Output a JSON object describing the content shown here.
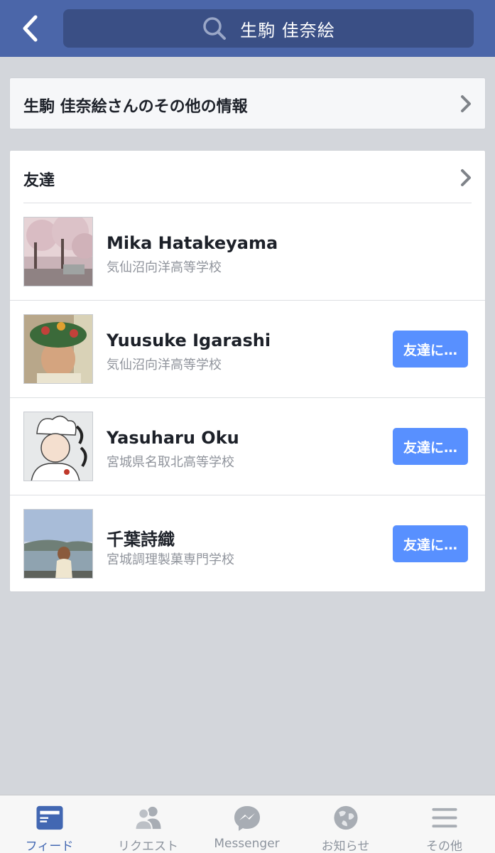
{
  "header": {
    "search_value": "生駒 佳奈絵"
  },
  "info_card": {
    "title": "生駒 佳奈絵さんのその他の情報"
  },
  "friends": {
    "title": "友達",
    "items": [
      {
        "name": "Mika Hatakeyama",
        "school": "気仙沼向洋高等学校",
        "button": ""
      },
      {
        "name": "Yuusuke Igarashi",
        "school": "気仙沼向洋高等学校",
        "button": "友達に…"
      },
      {
        "name": "Yasuharu Oku",
        "school": "宮城県名取北高等学校",
        "button": "友達に…"
      },
      {
        "name": "千葉詩織",
        "school": "宮城調理製菓専門学校",
        "button": "友達に…"
      }
    ]
  },
  "tabbar": {
    "tabs": [
      {
        "label": "フィード",
        "icon": "feed-icon",
        "active": true
      },
      {
        "label": "リクエスト",
        "icon": "friend-requests-icon",
        "active": false
      },
      {
        "label": "Messenger",
        "icon": "messenger-icon",
        "active": false
      },
      {
        "label": "お知らせ",
        "icon": "notifications-globe-icon",
        "active": false
      },
      {
        "label": "その他",
        "icon": "menu-icon",
        "active": false
      }
    ]
  },
  "colors": {
    "header": "#4b66a9",
    "search_box": "#3a4f85",
    "button": "#5890ff",
    "active_tab": "#4267b2",
    "background": "#d3d6db"
  }
}
